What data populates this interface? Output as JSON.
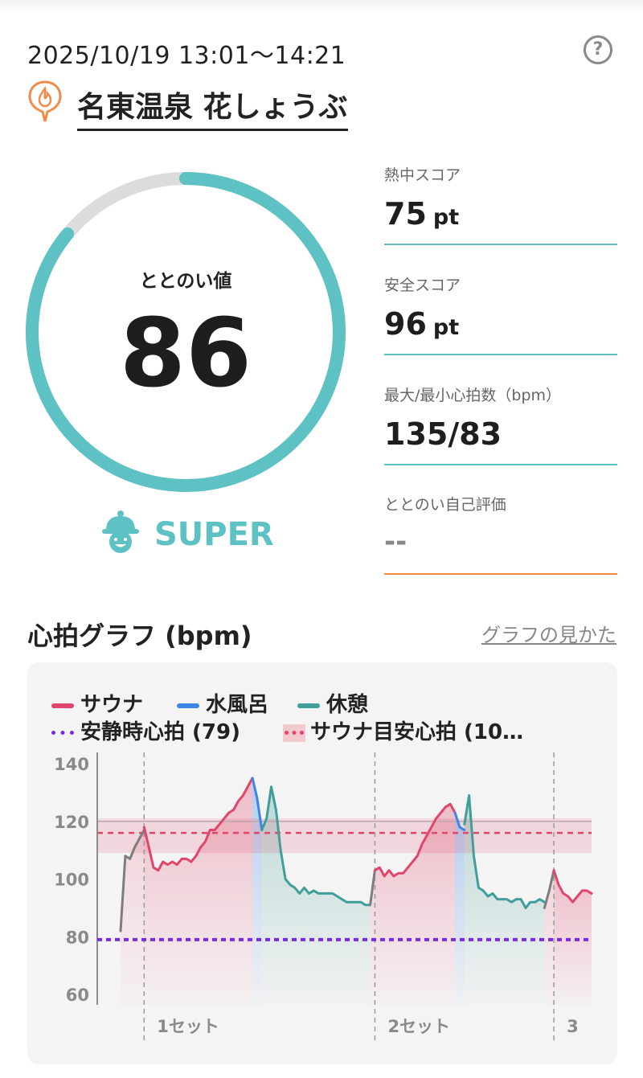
{
  "session": {
    "datetime": "2025/10/19 13:01〜14:21",
    "facility": "名東温泉 花しょうぶ"
  },
  "help_label": "?",
  "totonoi": {
    "label": "ととのい値",
    "value": "86",
    "score_fraction": 0.86,
    "rank": "SUPER"
  },
  "stats": [
    {
      "label": "熱中スコア",
      "value": "75",
      "unit": "pt"
    },
    {
      "label": "安全スコア",
      "value": "96",
      "unit": "pt"
    },
    {
      "label": "最大/最小心拍数（bpm）",
      "value": "135/83",
      "unit": ""
    },
    {
      "label": "ととのい自己評価",
      "value": "--",
      "unit": ""
    }
  ],
  "graph_section": {
    "title": "心拍グラフ (bpm)",
    "guide_link": "グラフの見かた"
  },
  "legend": {
    "sauna": "サウナ",
    "water": "水風呂",
    "rest": "休憩",
    "resting_hr": "安静時心拍 (79)",
    "sauna_target": "サウナ目安心拍 (10…"
  },
  "colors": {
    "accent": "#5ec1c4",
    "sauna": "#e0456a",
    "water": "#3b86e6",
    "rest": "#3f9f98",
    "resting": "#7a2be2",
    "idle": "#7d7d7d",
    "self_eval_line": "#f08b4a"
  },
  "chart_data": {
    "type": "line",
    "xlabel": "",
    "ylabel": "",
    "ylim": [
      55,
      143
    ],
    "yticks": [
      140,
      120,
      100,
      80,
      60
    ],
    "set_labels": [
      "1セット",
      "2セット",
      "3"
    ],
    "resting_hr": 79,
    "target_band": [
      109,
      121
    ],
    "target_line": 116,
    "series": [
      {
        "name": "サウナ",
        "phase": "idle",
        "x": [
          0,
          1,
          2,
          3,
          4,
          5
        ],
        "values": [
          82,
          108,
          107,
          111,
          114,
          117
        ]
      },
      {
        "name": "サウナ",
        "phase": "sauna",
        "x": [
          5,
          6,
          7,
          8,
          9,
          10,
          11,
          12,
          13,
          14,
          15,
          16,
          17,
          18,
          19,
          20,
          21,
          22,
          23,
          24,
          25,
          26,
          27,
          28
        ],
        "values": [
          118,
          111,
          104,
          103,
          106,
          105,
          106,
          105,
          107,
          107,
          106,
          108,
          111,
          113,
          117,
          117,
          119,
          121,
          123,
          124,
          127,
          129,
          132,
          135
        ]
      },
      {
        "name": "水風呂",
        "phase": "water",
        "x": [
          28,
          29,
          30
        ],
        "values": [
          135,
          128,
          117
        ]
      },
      {
        "name": "休憩",
        "phase": "rest",
        "x": [
          30,
          31,
          32,
          33,
          34,
          35,
          36,
          37,
          38,
          39,
          40,
          41,
          42,
          43,
          44,
          45,
          46,
          47,
          48,
          49,
          50,
          51,
          52,
          53
        ],
        "values": [
          117,
          121,
          132,
          124,
          110,
          100,
          98,
          97,
          95,
          97,
          95,
          96,
          95,
          95,
          95,
          95,
          94,
          93,
          92,
          92,
          92,
          92,
          91,
          91
        ]
      },
      {
        "name": "サウナ",
        "phase": "idle",
        "x": [
          53,
          54
        ],
        "values": [
          91,
          103
        ]
      },
      {
        "name": "サウナ",
        "phase": "sauna",
        "x": [
          54,
          55,
          56,
          57,
          58,
          59,
          60,
          61,
          62,
          63,
          64,
          65,
          66,
          67,
          68,
          69,
          70,
          71
        ],
        "values": [
          103,
          104,
          101,
          103,
          101,
          102,
          102,
          104,
          106,
          108,
          112,
          115,
          118,
          121,
          123,
          125,
          126,
          123
        ]
      },
      {
        "name": "水風呂",
        "phase": "water",
        "x": [
          71,
          72,
          73
        ],
        "values": [
          123,
          118,
          117
        ]
      },
      {
        "name": "休憩",
        "phase": "rest",
        "x": [
          73,
          74,
          75,
          76,
          77,
          78,
          79,
          80,
          81,
          82,
          83,
          84,
          85,
          86,
          87,
          88,
          89,
          90
        ],
        "values": [
          119,
          129,
          108,
          97,
          96,
          94,
          95,
          93,
          93,
          93,
          92,
          93,
          93,
          90,
          92,
          92,
          93,
          92
        ]
      },
      {
        "name": "サウナ",
        "phase": "idle",
        "x": [
          90,
          91,
          92
        ],
        "values": [
          90,
          96,
          103
        ]
      },
      {
        "name": "サウナ",
        "phase": "sauna",
        "x": [
          92,
          93,
          94,
          95,
          96,
          97,
          98,
          99,
          100
        ],
        "values": [
          103,
          98,
          95,
          94,
          92,
          94,
          96,
          96,
          95
        ]
      }
    ],
    "xlim": [
      0,
      100
    ],
    "set_boundaries": [
      5,
      54,
      92
    ]
  }
}
